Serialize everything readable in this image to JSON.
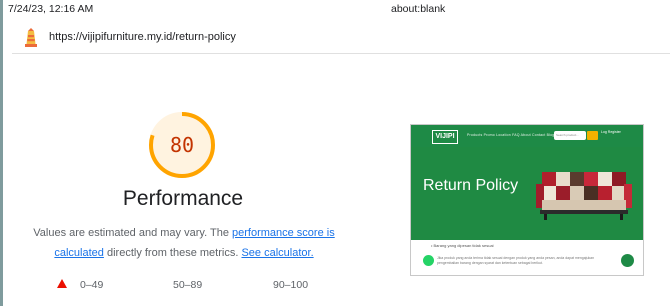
{
  "header": {
    "timestamp": "7/24/23, 12:16 AM",
    "tab_title": "about:blank"
  },
  "urlbar": {
    "icon": "lighthouse-icon",
    "url": "https://vijipifurniture.my.id/return-policy"
  },
  "performance": {
    "score": "80",
    "score_fraction": 0.8,
    "gauge_color": "#ffa400",
    "score_color": "#c33300",
    "title": "Performance",
    "desc_prefix": "Values are estimated and may vary. The ",
    "score_link": "performance score is calculated",
    "desc_mid": " directly from these metrics. ",
    "calc_link": "See calculator."
  },
  "legend": {
    "fail": "0–49",
    "average": "50–89",
    "pass": "90–100",
    "fail_color": "#eb0f00"
  },
  "thumbnail": {
    "logo": "VIJIPI",
    "nav_links": "Products  Promo  Location  FAQ  About  Contact  Blog",
    "search_placeholder": "Search product...",
    "nav_right": "Log   Register",
    "hero_title": "Return Policy",
    "bullet": "• Barang yang dipesan tidak sesuai",
    "small_text": "Jika produk yang anda terima tidak sesuai dengan produk yang anda pesan, anda dapat mengajukan pengembalian barang dengan syarat dan ketentuan sebagai berikut.",
    "brand_color": "#1e8a46"
  }
}
